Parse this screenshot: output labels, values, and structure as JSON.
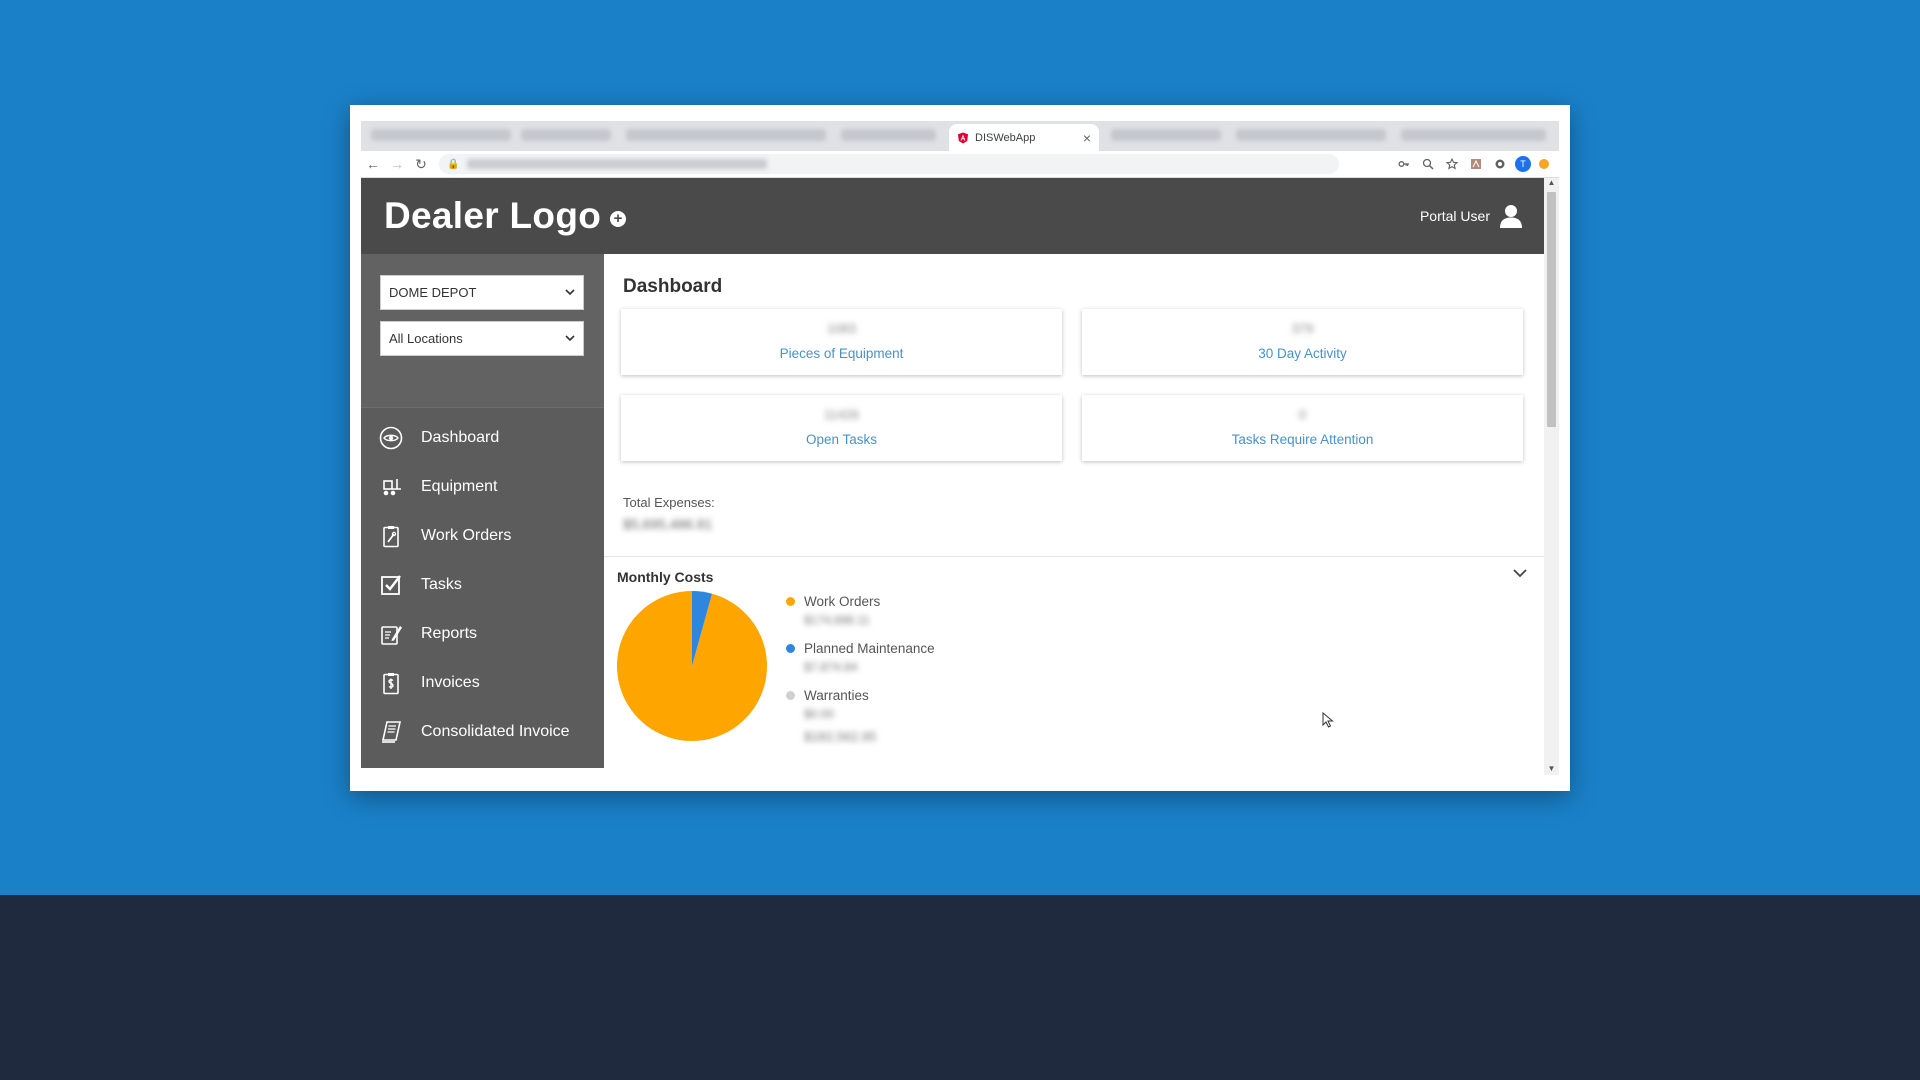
{
  "browser": {
    "active_tab_title": "DISWebApp",
    "tab_close": "×",
    "nav": {
      "back": "←",
      "forward": "→",
      "reload": "↻"
    },
    "lock": "🔒",
    "profile_initial": "T",
    "toolbar_icons": [
      "key-icon",
      "zoom-icon",
      "star-icon",
      "pdf-extension-icon",
      "extension-icon"
    ]
  },
  "header": {
    "logo": "Dealer Logo",
    "logo_plus": "+",
    "user_label": "Portal User"
  },
  "sidebar": {
    "company_select": "DOME DEPOT",
    "location_select": "All Locations",
    "items": [
      {
        "label": "Dashboard",
        "icon": "eye-icon"
      },
      {
        "label": "Equipment",
        "icon": "forklift-icon"
      },
      {
        "label": "Work Orders",
        "icon": "clipboard-wrench-icon"
      },
      {
        "label": "Tasks",
        "icon": "checkbox-icon"
      },
      {
        "label": "Reports",
        "icon": "report-edit-icon"
      },
      {
        "label": "Invoices",
        "icon": "invoice-dollar-icon"
      },
      {
        "label": "Consolidated Invoice",
        "icon": "stacked-invoice-icon"
      }
    ]
  },
  "main": {
    "title": "Dashboard",
    "cards": [
      {
        "value": "1083",
        "label": "Pieces of Equipment"
      },
      {
        "value": "379",
        "label": "30 Day Activity"
      },
      {
        "value": "11426",
        "label": "Open Tasks"
      },
      {
        "value": "0",
        "label": "Tasks Require Attention"
      }
    ],
    "expenses_label": "Total Expenses:",
    "expenses_value": "$5,695,486.81",
    "monthly_costs": {
      "title": "Monthly Costs",
      "legend": [
        {
          "label": "Work Orders",
          "value": "$174,688.11",
          "color": "#ffa500"
        },
        {
          "label": "Planned Maintenance",
          "value": "$7,874.84",
          "color": "#2e86de"
        },
        {
          "label": "Warranties",
          "value": "$0.00",
          "color": "#d0d0d0"
        }
      ],
      "total": "$182,562.95"
    }
  },
  "chart_data": {
    "type": "pie",
    "labels": [
      "Work Orders",
      "Planned Maintenance",
      "Warranties"
    ],
    "values": [
      95.7,
      4.3,
      0
    ],
    "colors": [
      "#ffa500",
      "#2e86de",
      "#d0d0d0"
    ]
  }
}
